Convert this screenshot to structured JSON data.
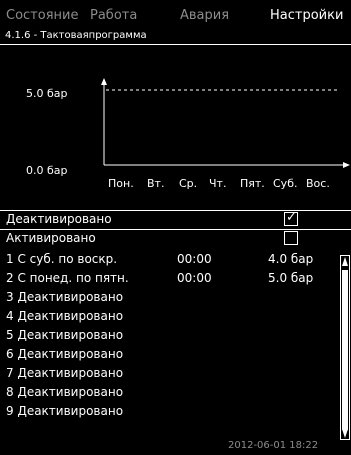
{
  "tabs": [
    {
      "label": "Состояние",
      "active": false
    },
    {
      "label": "Работа",
      "active": false
    },
    {
      "label": "Авария",
      "active": false
    },
    {
      "label": "Настройки",
      "active": true
    }
  ],
  "menu_path": "4.1.6 - Тактоваяпрограмма",
  "chart": {
    "y_top_label": "5.0 бар",
    "y_bottom_label": "0.0 бар",
    "days": [
      "Пон.",
      "Вт.",
      "Ср.",
      "Чт.",
      "Пят.",
      "Суб.",
      "Вос."
    ]
  },
  "options": [
    {
      "label": "Деактивировано",
      "checked": true,
      "selected": true
    },
    {
      "label": "Активировано",
      "checked": false,
      "selected": false
    }
  ],
  "events": [
    {
      "text": "1  С суб. по воскр.",
      "time": "00:00",
      "value": "4.0 бар"
    },
    {
      "text": "2  С понед. по пятн.",
      "time": "00:00",
      "value": "5.0 бар"
    },
    {
      "text": "3  Деактивировано",
      "time": "",
      "value": ""
    },
    {
      "text": "4  Деактивировано",
      "time": "",
      "value": ""
    },
    {
      "text": "5  Деактивировано",
      "time": "",
      "value": ""
    },
    {
      "text": "6  Деактивировано",
      "time": "",
      "value": ""
    },
    {
      "text": "7  Деактивировано",
      "time": "",
      "value": ""
    },
    {
      "text": "8  Деактивировано",
      "time": "",
      "value": ""
    },
    {
      "text": "9  Деактивировано",
      "time": "",
      "value": ""
    }
  ],
  "timestamp": "2012-06-01 18:22"
}
